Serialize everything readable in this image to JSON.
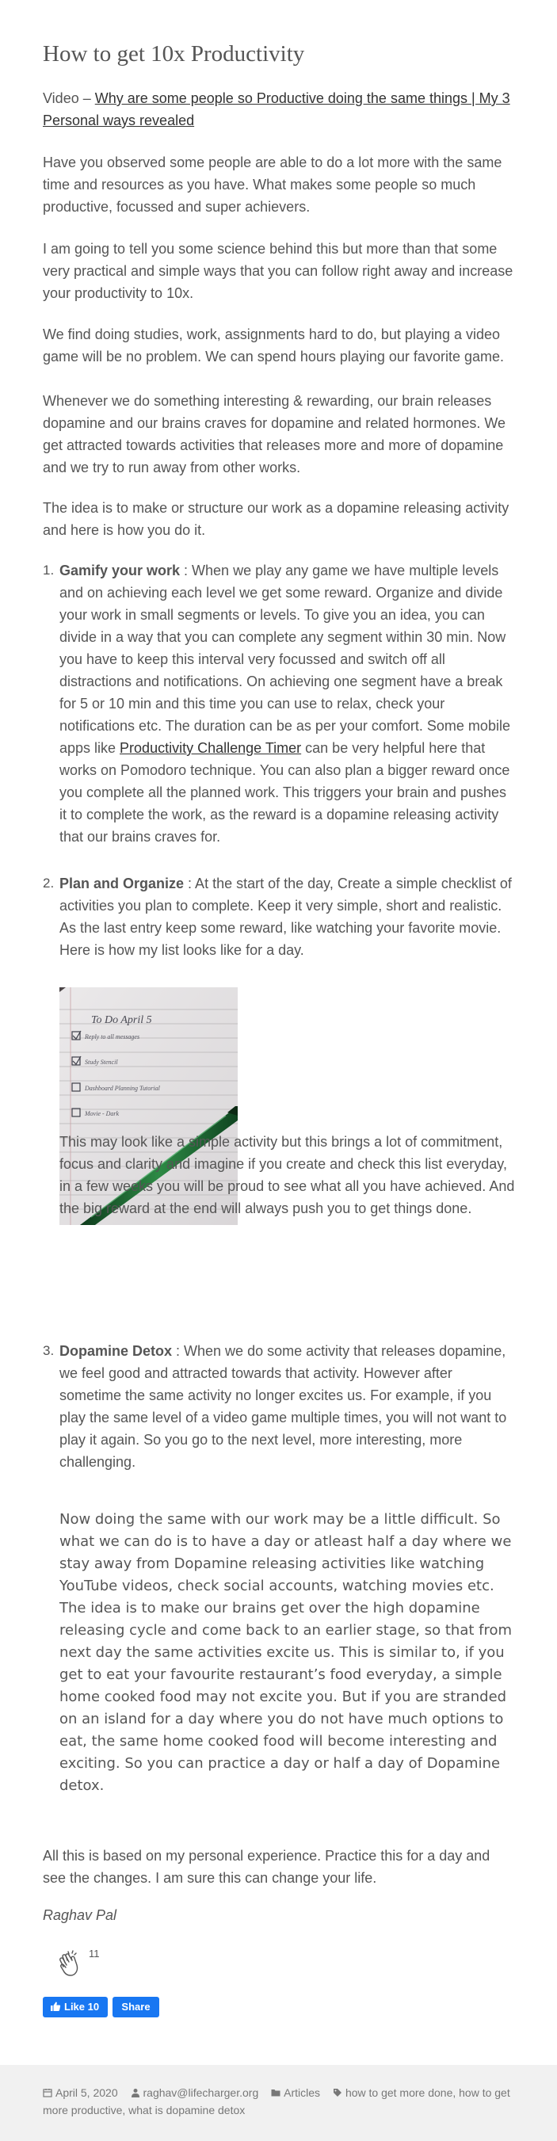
{
  "title": "How to get 10x Productivity",
  "video": {
    "prefix": "Video – ",
    "link": "Why are some people so Productive doing the same things | My 3 Personal ways revealed"
  },
  "paragraphs": [
    "Have you observed some people are able to do a lot more with the same time and resources as you have. What makes some people so much productive, focussed and super achievers.",
    "I am going to tell you some science behind this but more than that some very practical and simple ways that you can follow right away and increase your productivity to 10x.",
    "We find doing studies, work, assignments hard to do, but playing a video game will be no problem. We can spend hours playing our favorite game.",
    "Whenever we do something interesting & rewarding, our brain releases dopamine and our brains craves for dopamine and related hormones. We get attracted towards activities that releases more and more of dopamine and we try to run away from other works.",
    "The idea is to make or structure our work as a dopamine releasing activity and here is how you do it."
  ],
  "items": [
    {
      "num": "1.",
      "heading": "Gamify your work",
      "text_before": " : When we play any game we have multiple levels and on achieving each level we get some reward. Organize and divide your work in small segments or levels. To give you an idea, you can divide in a way that you can complete any segment within 30 min. Now you have to keep this interval very focussed and switch off all distractions and notifications. On achieving one segment have a break for 5 or 10 min and this time you can use to relax, check your notifications etc. The duration can be as per your comfort. Some mobile apps like ",
      "link": "Productivity Challenge Timer",
      "text_after": " can be very helpful here that works on Pomodoro technique. You can also plan a bigger reward once you complete all the planned work. This triggers your brain and pushes it to complete the work, as the reward is a dopamine releasing activity that our brains craves for."
    },
    {
      "num": "2.",
      "heading": "Plan and Organize",
      "text": " : At the start of the day, Create a simple checklist of activities you plan to complete. Keep it very simple, short and realistic. As the last entry keep some reward, like watching your favorite movie. Here is how my list looks like for a day.",
      "photo": {
        "title": "To Do  April 5",
        "entries": [
          "Reply to all messages",
          "Study Stencil",
          "Dashboard Planning Tutorial",
          "Movie - Dark"
        ]
      },
      "after": "This may look like a simple activity but this brings a lot of commitment, focus and clarity and imagine if you create and check this list everyday, in a few weeks you will be proud to see what all you have achieved. And the big reward at the end will always push you to get things done."
    },
    {
      "num": "3.",
      "heading": "Dopamine Detox",
      "text": " : When we do some activity that releases dopamine, we feel good and attracted towards that activity. However after sometime the same activity no longer excites us. For example, if you play the same level of a video game multiple times, you will not want to play it again. So you go to the next level, more interesting, more challenging.",
      "detox": "Now doing the same with our work may be a little difficult. So what we can do is to have a day or atleast half a day where we stay away from Dopamine releasing activities like watching YouTube videos, check social accounts, watching movies etc. The idea is to make our brains get over the high dopamine releasing cycle and come back to an earlier stage, so that from next day the same activities excite us. This is similar to, if you get to eat your favourite restaurant’s food everyday, a simple home cooked food may not excite you. But if you are stranded on an island for a day where you do not have much options to eat, the same home cooked food will become interesting and exciting.  So you can practice a day or half a day of Dopamine detox."
    }
  ],
  "closing": "All this is based on my personal experience. Practice this for a day and see the changes. I am sure this can change your life.",
  "author": "Raghav Pal",
  "clap_count": "11",
  "like_label": "Like 10",
  "share_label": "Share",
  "footer": {
    "date": "April 5, 2020",
    "email": "raghav@lifecharger.org",
    "category": "Articles",
    "tags": "how to get more done, how to get more productive, what is dopamine detox"
  },
  "colors": {
    "text": "#555555",
    "fb_blue": "#1877f2",
    "footer_bg": "#f1f1f1"
  }
}
